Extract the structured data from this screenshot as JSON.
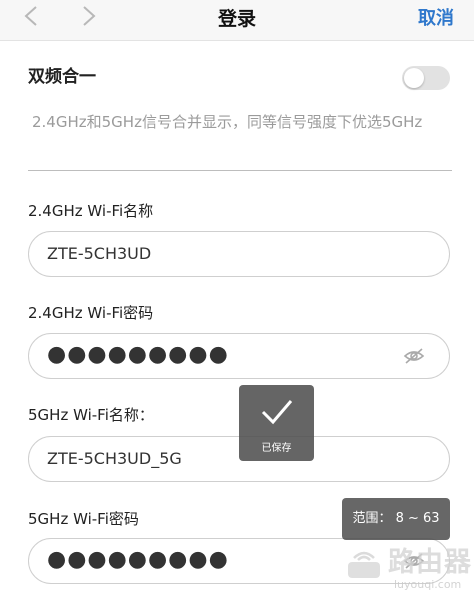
{
  "header": {
    "title": "登录",
    "cancel_label": "取消"
  },
  "dual_band": {
    "label": "双频合一",
    "enabled": false,
    "description": "2.4GHz和5GHz信号合并显示，同等信号强度下优选5GHz"
  },
  "wifi_24": {
    "name_label": "2.4GHz Wi-Fi名称",
    "name_value": "ZTE-5CH3UD",
    "password_label": "2.4GHz Wi-Fi密码",
    "password_value": "●●●●●●●●●"
  },
  "wifi_5": {
    "name_label": "5GHz Wi-Fi名称：",
    "name_value": "ZTE-5CH3UD_5G",
    "password_label": "5GHz Wi-Fi密码",
    "password_value": "●●●●●●●●●"
  },
  "toast": {
    "text": "已保存"
  },
  "range_tip": {
    "text": "范围： 8 ~ 63"
  },
  "watermark": {
    "text": "路由器",
    "sub": "luyouqi.com"
  },
  "colors": {
    "accent": "#2f78cc",
    "toggle_off": "#e2e2e2"
  }
}
